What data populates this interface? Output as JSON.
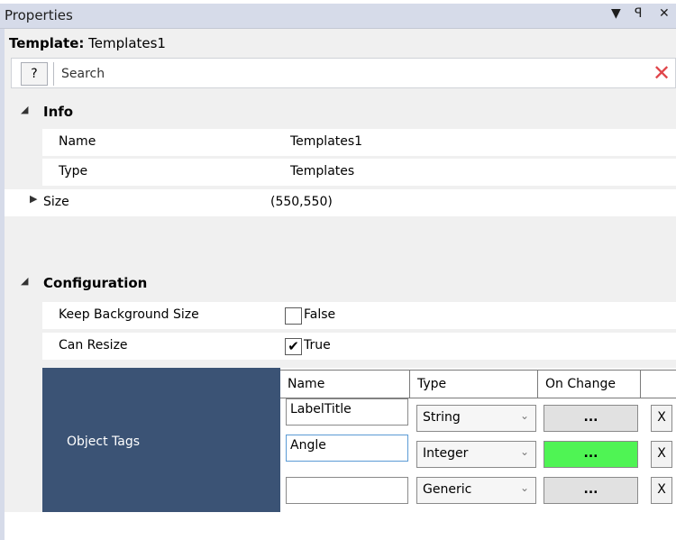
{
  "window": {
    "title": "Properties",
    "controls": {
      "dropdown_icon": "▼",
      "pin_icon": "ꟼ",
      "close_icon": "✕"
    }
  },
  "template": {
    "label": "Template:",
    "name": "Templates1"
  },
  "search": {
    "help_label": "?",
    "placeholder": "Search",
    "clear_icon": "✕",
    "accent": "#e0454a"
  },
  "categories": {
    "info": {
      "label": "Info",
      "expanded": true
    },
    "configuration": {
      "label": "Configuration",
      "expanded": true
    }
  },
  "info_rows": [
    {
      "key": "Name",
      "value": "Templates1"
    },
    {
      "key": "Type",
      "value": "Templates"
    },
    {
      "key": "Size",
      "value": "(550,550)",
      "collapsed": true
    }
  ],
  "config_rows": [
    {
      "key": "Keep Background Size",
      "checked": false,
      "value": "False"
    },
    {
      "key": "Can Resize",
      "checked": true,
      "value": "True"
    }
  ],
  "object_tags": {
    "label": "Object Tags",
    "label_bg": "#3b5375",
    "columns": [
      "Name",
      "Type",
      "On Change",
      ""
    ],
    "rows": [
      {
        "name": "LabelTitle",
        "type": "String",
        "on_change": "...",
        "remove": "X",
        "highlight": false
      },
      {
        "name": "Angle",
        "type": "Integer",
        "on_change": "...",
        "remove": "X",
        "highlight": true
      },
      {
        "name": "",
        "type": "Generic",
        "on_change": "...",
        "remove": "X",
        "highlight": false
      }
    ],
    "highlight_color": "#4ff454"
  }
}
